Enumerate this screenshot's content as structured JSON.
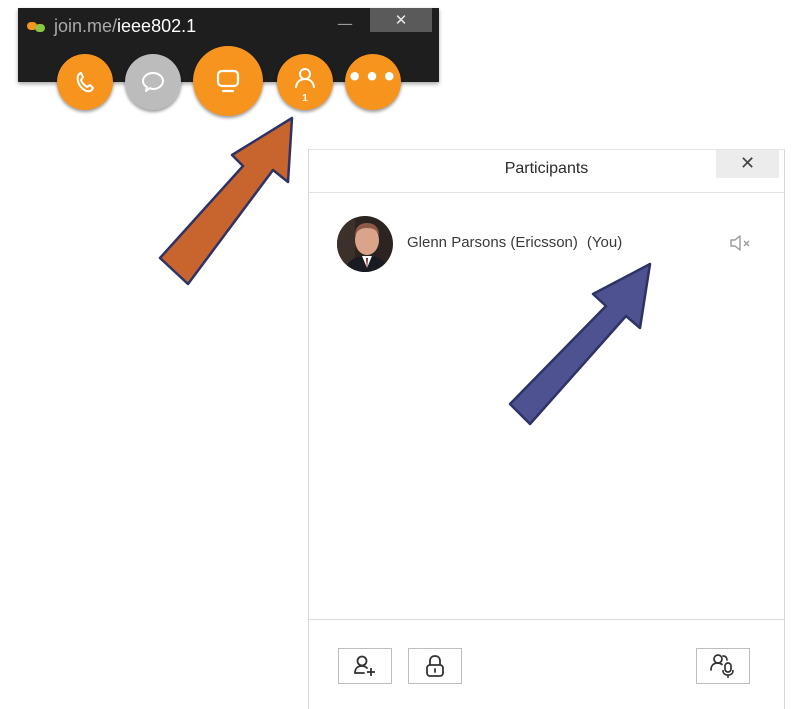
{
  "toolbar": {
    "url_host": "join.me/",
    "url_path": "ieee802.1",
    "minimize_glyph": "—",
    "close_glyph": "✕",
    "buttons": [
      {
        "name": "phone",
        "icon": "phone-icon",
        "color": "#f7941d"
      },
      {
        "name": "chat",
        "icon": "chat-bubble-icon",
        "color": "#bcbcbc"
      },
      {
        "name": "screen-share",
        "icon": "monitor-icon",
        "color": "#f7941d"
      },
      {
        "name": "participants",
        "icon": "person-icon",
        "color": "#f7941d",
        "badge": "1"
      },
      {
        "name": "more",
        "icon": "more-dots-icon",
        "color": "#f7941d"
      }
    ],
    "more_glyph": "•••"
  },
  "panel": {
    "title": "Participants",
    "close_glyph": "✕",
    "participants": [
      {
        "name": "Glenn Parsons (Ericsson)",
        "tag": "(You)",
        "muted": true,
        "icon": "speaker-muted-icon"
      }
    ],
    "footer_buttons": [
      {
        "name": "add-participant",
        "icon": "add-person-icon"
      },
      {
        "name": "lock-meeting",
        "icon": "lock-icon"
      },
      {
        "name": "presenter-audio",
        "icon": "people-mic-icon"
      }
    ]
  },
  "colors": {
    "accent": "#f7941d",
    "toolbar_bg": "#1e1e1e",
    "arrow_orange": "#c8652e",
    "arrow_blue": "#4f5290",
    "arrow_outline": "#2e3366"
  }
}
